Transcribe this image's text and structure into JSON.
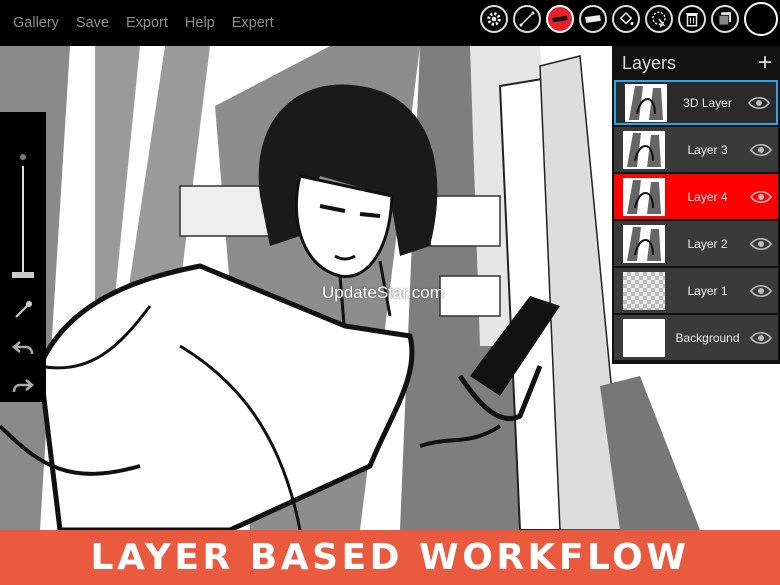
{
  "menu": {
    "gallery": "Gallery",
    "save": "Save",
    "export": "Export",
    "help": "Help",
    "expert": "Expert"
  },
  "toolbar": {
    "icons": [
      "gear-icon",
      "ruler-icon",
      "brush-icon",
      "eraser-icon",
      "fill-bucket-icon",
      "lasso-select-icon",
      "trash-icon",
      "layer-stack-icon",
      "color-swatch-icon"
    ],
    "active_tool": "brush-icon",
    "accent_color": "#e8222c",
    "current_color": "#000000"
  },
  "left_toolbar": {
    "brush_size_fraction": 0.05,
    "icons": [
      "eyedropper-icon",
      "undo-icon",
      "redo-icon"
    ]
  },
  "layers_panel": {
    "title": "Layers",
    "add_icon": "plus-icon",
    "selection_color": "#2ba6e8",
    "active_color": "#ff0000",
    "layers": [
      {
        "name": "3D Layer",
        "state": "selected",
        "visible": true
      },
      {
        "name": "Layer 3",
        "state": "normal",
        "visible": true
      },
      {
        "name": "Layer 4",
        "state": "active",
        "visible": true
      },
      {
        "name": "Layer 2",
        "state": "normal",
        "visible": true
      },
      {
        "name": "Layer 1",
        "state": "normal",
        "visible": true
      },
      {
        "name": "Background",
        "state": "normal",
        "visible": true
      }
    ]
  },
  "watermark": "UpdateStar.com",
  "banner": {
    "text": "LAYER BASED WORKFLOW",
    "color": "#ea5a3f"
  }
}
